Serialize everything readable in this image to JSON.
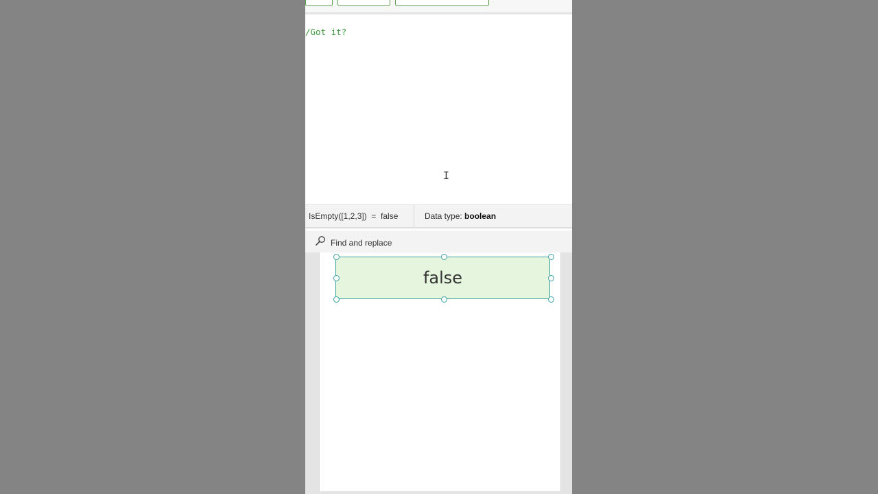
{
  "editor": {
    "comment_line": "/Got it?"
  },
  "result": {
    "expression": "IsEmpty([1,2,3])  =  false",
    "type_prefix": "Data type: ",
    "type_value": "boolean"
  },
  "find": {
    "label": "Find and replace",
    "icon": "search-icon"
  },
  "canvas": {
    "label_value": "false",
    "label_fill": "#e6f5de",
    "selection_color": "#3aa0a0"
  },
  "colors": {
    "comment": "#3f9a3f",
    "toolbar_border": "#5a9a4a"
  }
}
